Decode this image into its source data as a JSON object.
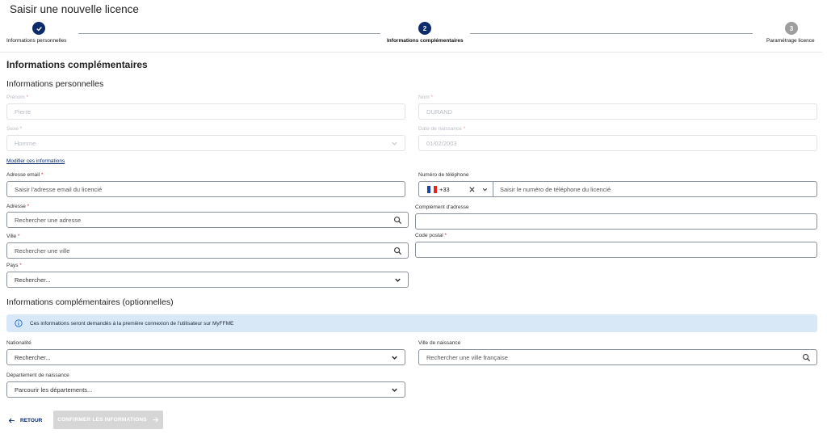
{
  "page": {
    "title": "Saisir une nouvelle licence"
  },
  "stepper": {
    "steps": [
      {
        "number": "1",
        "label": "Informations personnelles",
        "state": "done"
      },
      {
        "number": "2",
        "label": "Informations complémentaires",
        "state": "active"
      },
      {
        "number": "3",
        "label": "Paramétrage licence",
        "state": "todo"
      }
    ]
  },
  "section": {
    "title": "Informations complémentaires"
  },
  "personal": {
    "title": "Informations personnelles",
    "prenom": {
      "label": "Prénom",
      "value": "Pierre"
    },
    "nom": {
      "label": "Nom",
      "value": "DURAND"
    },
    "sexe": {
      "label": "Sexe",
      "value": "Homme"
    },
    "naissance": {
      "label": "Date de naissance",
      "value": "01/02/2003"
    },
    "edit_link": "Modifier ces informations"
  },
  "contact": {
    "email": {
      "label": "Adresse email",
      "placeholder": "Saisir l'adresse email du licencié"
    },
    "phone": {
      "label": "Numéro de téléphone",
      "prefix": "+33",
      "placeholder": "Saisir le numéro de téléphone du licencié"
    },
    "adresse": {
      "label": "Adresse",
      "placeholder": "Rechercher une adresse"
    },
    "complement": {
      "label": "Complément d'adresse",
      "placeholder": ""
    },
    "ville": {
      "label": "Ville",
      "placeholder": "Rechercher une ville"
    },
    "code_postal": {
      "label": "Code postal",
      "placeholder": ""
    },
    "pays": {
      "label": "Pays",
      "value": "Rechercher..."
    }
  },
  "optional": {
    "title": "Informations complémentaires (optionnelles)",
    "info": "Ces informations seront demandés à la première connexion de l'utilisateur sur MyFFME",
    "nationalite": {
      "label": "Nationalité",
      "value": "Rechercher..."
    },
    "ville_naissance": {
      "label": "Ville de naissance",
      "placeholder": "Rechercher une ville française"
    },
    "departement": {
      "label": "Département de naissance",
      "value": "Parcourir les départements..."
    }
  },
  "actions": {
    "back": "RETOUR",
    "confirm": "CONFIRMER LES INFORMATIONS"
  },
  "colors": {
    "primary": "#0c2b6b",
    "info_bg": "#d9e8f7",
    "required": "#d32f2f",
    "disabled_btn": "#d6d6d6"
  }
}
